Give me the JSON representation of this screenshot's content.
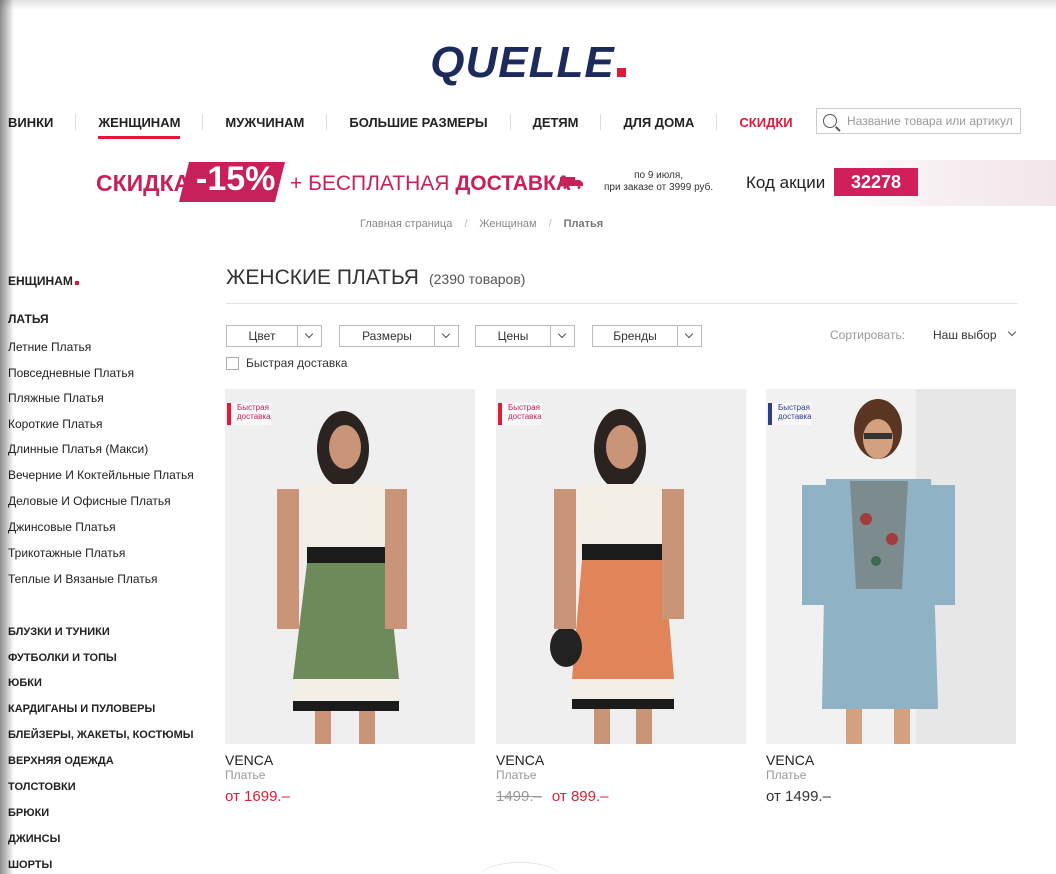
{
  "logo": {
    "text": "QUELLE"
  },
  "nav": {
    "items": [
      {
        "label": "ВИНКИ",
        "active": false,
        "sale": false
      },
      {
        "label": "ЖЕНЩИНАМ",
        "active": true,
        "sale": false
      },
      {
        "label": "МУЖЧИНАМ",
        "active": false,
        "sale": false
      },
      {
        "label": "БОЛЬШИЕ РАЗМЕРЫ",
        "active": false,
        "sale": false
      },
      {
        "label": "ДЕТЯМ",
        "active": false,
        "sale": false
      },
      {
        "label": "ДЛЯ ДОМА",
        "active": false,
        "sale": false
      },
      {
        "label": "СКИДКИ",
        "active": false,
        "sale": true
      }
    ],
    "search_placeholder": "Название товара или артикул"
  },
  "banner": {
    "skidka": "СКИДКА",
    "discount": "-15%",
    "free_prefix": "+ БЕСПЛАТНАЯ",
    "free_bold": "ДОСТАВКА",
    "terms_line1": "по 9 июля,",
    "terms_line2": "при заказе от 3999 руб.",
    "code_label": "Код акции",
    "code": "32278"
  },
  "breadcrumb": {
    "home": "Главная страница",
    "section": "Женщинам",
    "current": "Платья",
    "sep": "/"
  },
  "sidebar": {
    "head": "ЕНЩИНАМ",
    "sub_head": "ЛАТЬЯ",
    "dresses": [
      "Летние Платья",
      "Повседневные Платья",
      "Пляжные Платья",
      "Короткие Платья",
      "Длинные Платья (Макси)",
      "Вечерние И Коктейльные Платья",
      "Деловые И Офисные Платья",
      "Джинсовые Платья",
      "Трикотажные Платья",
      "Теплые И Вязаные Платья"
    ],
    "categories": [
      "БЛУЗКИ И ТУНИКИ",
      "ФУТБОЛКИ И ТОПЫ",
      "ЮБКИ",
      "КАРДИГАНЫ И ПУЛОВЕРЫ",
      "БЛЕЙЗЕРЫ, ЖАКЕТЫ, КОСТЮМЫ",
      "ВЕРХНЯЯ ОДЕЖДА",
      "ТОЛСТОВКИ",
      "БРЮКИ",
      "ДЖИНСЫ",
      "ШОРТЫ"
    ]
  },
  "main": {
    "title": "ЖЕНСКИЕ ПЛАТЬЯ",
    "count": "(2390 товаров)",
    "filters": [
      "Цвет",
      "Размеры",
      "Цены",
      "Бренды"
    ],
    "fast_delivery": "Быстрая доставка",
    "sort_label": "Сортировать:",
    "sort_value": "Наш выбор"
  },
  "products": [
    {
      "badge": "Быстрая\nдоставка",
      "brand": "VENCA",
      "type": "Платье",
      "old_price": "",
      "price": "от 1699.–",
      "dress_top": "#f3efe6",
      "dress_bottom": "#6e8a5a",
      "accent": "#e0193a"
    },
    {
      "badge": "Быстрая\nдоставка",
      "brand": "VENCA",
      "type": "Платье",
      "old_price": "1499.–",
      "price": "от 899.–",
      "dress_top": "#f3efe6",
      "dress_bottom": "#e0845a",
      "accent": "#e0193a"
    },
    {
      "badge": "Быстрая\nдоставка",
      "brand": "VENCA",
      "type": "Платье",
      "old_price": "",
      "price": "от 1499.–",
      "dress_top": "#8fb3c5",
      "dress_bottom": "#8fb3c5",
      "accent": "#2c3e8c"
    }
  ],
  "colors": {
    "brand_navy": "#1c2a5c",
    "accent_red": "#e0193a",
    "promo_pink": "#c8205a"
  }
}
